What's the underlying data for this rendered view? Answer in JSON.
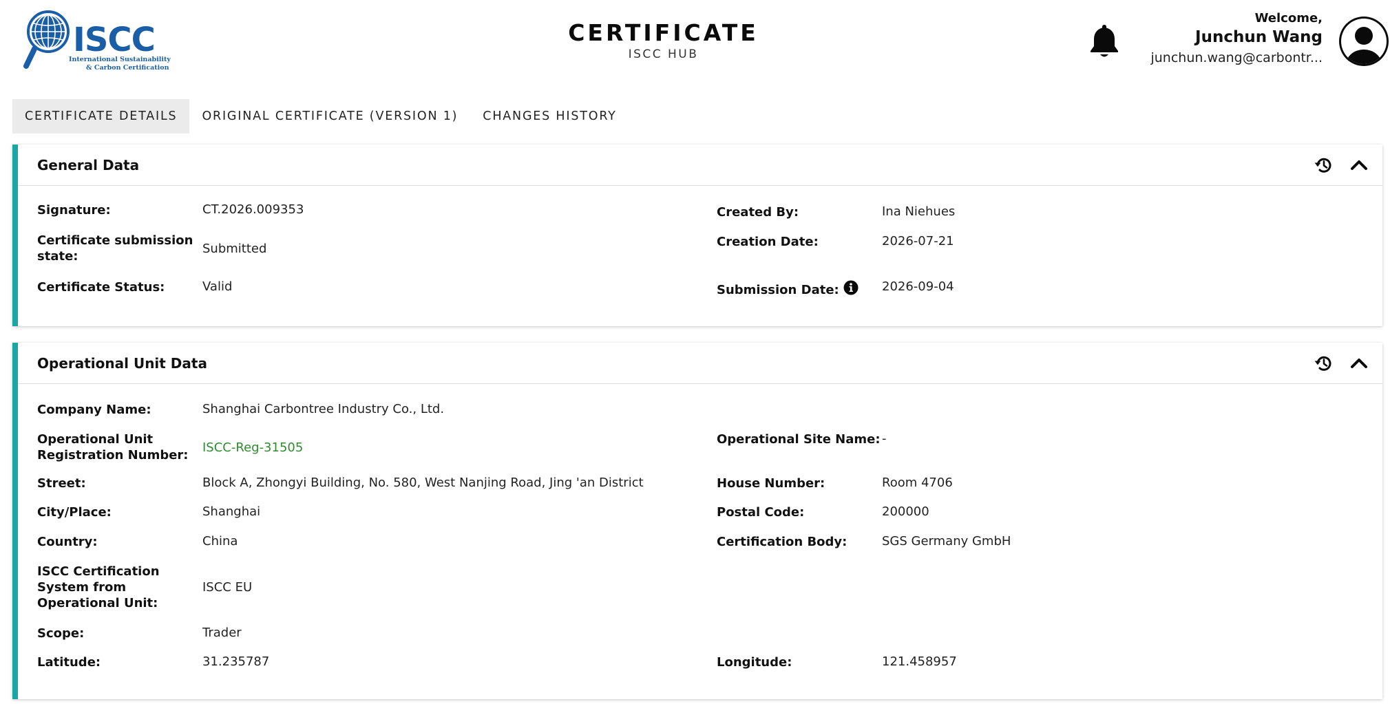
{
  "header": {
    "logo": {
      "brand": "ISCC",
      "tagline_line1": "International Sustainability",
      "tagline_line2": "& Carbon Certification"
    },
    "title": "CERTIFICATE",
    "subtitle": "ISCC HUB",
    "user": {
      "welcome": "Welcome,",
      "name": "Junchun Wang",
      "email": "junchun.wang@carbontr..."
    },
    "icons": {
      "notifications": "bell-icon",
      "profile": "user-avatar-icon"
    }
  },
  "tabs": [
    {
      "label": "CERTIFICATE DETAILS",
      "active": true
    },
    {
      "label": "ORIGINAL CERTIFICATE (VERSION 1)",
      "active": false
    },
    {
      "label": "CHANGES HISTORY",
      "active": false
    }
  ],
  "general_data": {
    "title": "General Data",
    "fields": {
      "signature": {
        "label": "Signature:",
        "value": "CT.2026.009353"
      },
      "submission_state": {
        "label": "Certificate submission state:",
        "value": "Submitted"
      },
      "status": {
        "label": "Certificate Status:",
        "value": "Valid"
      },
      "created_by": {
        "label": "Created By:",
        "value": "Ina Niehues"
      },
      "creation_date": {
        "label": "Creation Date:",
        "value": "2026-07-21"
      },
      "submission_date": {
        "label": "Submission Date:",
        "value": "2026-09-04"
      }
    }
  },
  "operational_unit_data": {
    "title": "Operational Unit Data",
    "fields": {
      "company_name": {
        "label": "Company Name:",
        "value": "Shanghai Carbontree Industry Co., Ltd."
      },
      "registration_number": {
        "label": "Operational Unit Registration Number:",
        "value": "ISCC-Reg-31505"
      },
      "site_name": {
        "label": "Operational Site Name:",
        "value": "-"
      },
      "street": {
        "label": "Street:",
        "value": "Block A, Zhongyi Building, No. 580, West Nanjing Road, Jing 'an District"
      },
      "house_number": {
        "label": "House Number:",
        "value": "Room 4706"
      },
      "city": {
        "label": "City/Place:",
        "value": "Shanghai"
      },
      "postal_code": {
        "label": "Postal Code:",
        "value": "200000"
      },
      "country": {
        "label": "Country:",
        "value": "China"
      },
      "certification_body": {
        "label": "Certification Body:",
        "value": "SGS Germany GmbH"
      },
      "certification_system": {
        "label": "ISCC Certification System from Operational Unit:",
        "value": "ISCC EU"
      },
      "scope": {
        "label": "Scope:",
        "value": "Trader"
      },
      "latitude": {
        "label": "Latitude:",
        "value": "31.235787"
      },
      "longitude": {
        "label": "Longitude:",
        "value": "121.458957"
      }
    }
  },
  "colors": {
    "accent_teal": "#1aa7a4",
    "brand_blue": "#1b5ea8",
    "link_green": "#2e8b2e",
    "active_tab_bg": "#ebebeb"
  }
}
